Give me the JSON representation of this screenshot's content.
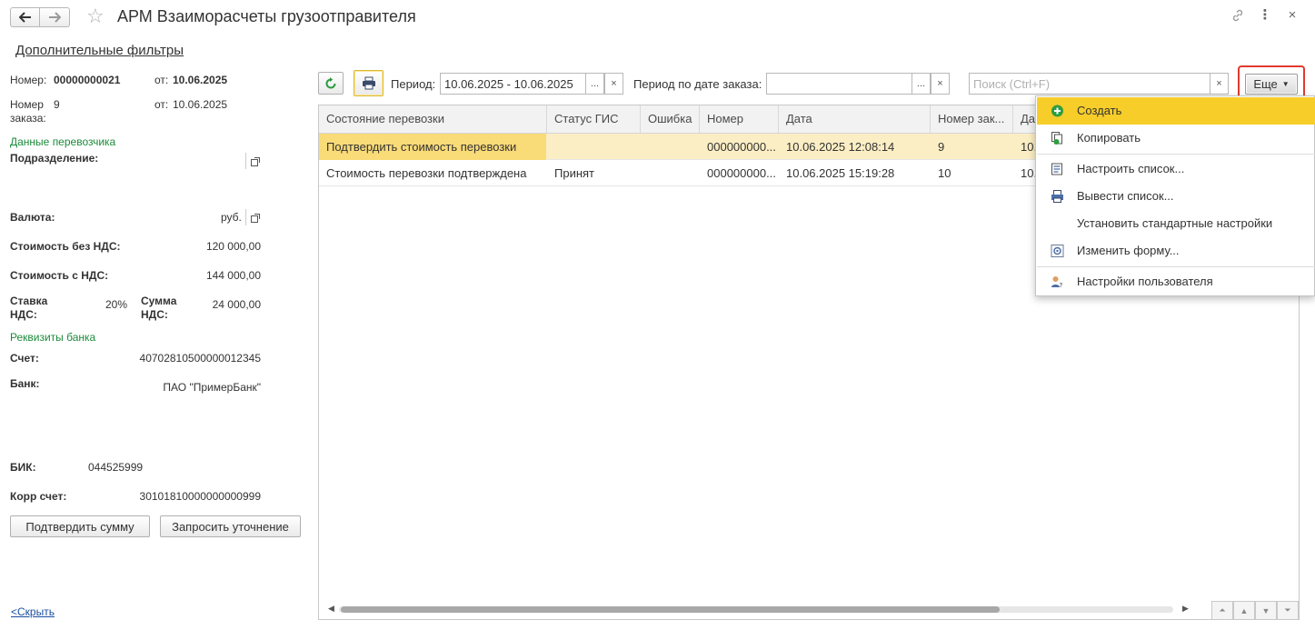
{
  "window": {
    "title": "АРМ Взаиморасчеты грузоотправителя"
  },
  "extra_filters_link": "Дополнительные фильтры",
  "left_panel": {
    "number_label": "Номер:",
    "number_value": "00000000021",
    "from_label_1": "от:",
    "from_value_1": "10.06.2025",
    "order_label_1": "Номер",
    "order_label_2": "заказа:",
    "order_value": "9",
    "from_label_2": "от:",
    "from_value_2": "10.06.2025",
    "carrier_section": "Данные перевозчика",
    "department_label": "Подразделение:",
    "currency_label": "Валюта:",
    "currency_value": "руб.",
    "cost_no_vat_label": "Стоимость без НДС:",
    "cost_no_vat_value": "120 000,00",
    "cost_vat_label": "Стоимость с НДС:",
    "cost_vat_value": "144 000,00",
    "vat_rate_label_1": "Ставка",
    "vat_rate_label_2": "НДС:",
    "vat_rate_value": "20%",
    "vat_sum_label_1": "Сумма",
    "vat_sum_label_2": "НДС:",
    "vat_sum_value": "24 000,00",
    "bank_section": "Реквизиты банка",
    "account_label": "Счет:",
    "account_value": "40702810500000012345",
    "bank_label": "Банк:",
    "bank_value": "ПАО \"ПримерБанк\"",
    "bik_label": "БИК:",
    "bik_value": "044525999",
    "corr_label": "Корр счет:",
    "corr_value": "30101810000000000999",
    "confirm_button": "Подтвердить сумму",
    "clarify_button": "Запросить уточнение",
    "hide_link": "<Скрыть"
  },
  "toolbar": {
    "period_label": "Период:",
    "period_value": "10.06.2025 - 10.06.2025",
    "order_period_label": "Период по дате заказа:",
    "order_period_value": "",
    "search_placeholder": "Поиск (Ctrl+F)",
    "more_button": "Еще",
    "ellipsis": "...",
    "clear": "×"
  },
  "table": {
    "columns": [
      "Состояние перевозки",
      "Статус ГИС",
      "Ошибка",
      "Номер",
      "Дата",
      "Номер зак...",
      "Да"
    ],
    "rows": [
      [
        "Подтвердить стоимость перевозки",
        "",
        "",
        "000000000...",
        "10.06.2025 12:08:14",
        "9",
        "10."
      ],
      [
        "Стоимость перевозки подтверждена",
        "Принят",
        "",
        "000000000...",
        "10.06.2025 15:19:28",
        "10",
        "10."
      ]
    ]
  },
  "menu": {
    "items": [
      {
        "label": "Создать",
        "icon": "plus-circle-icon"
      },
      {
        "label": "Копировать",
        "icon": "copy-icon"
      },
      {
        "label": "Настроить список...",
        "icon": "list-settings-icon"
      },
      {
        "label": "Вывести список...",
        "icon": "print-list-icon"
      },
      {
        "label": "Установить стандартные настройки",
        "icon": ""
      },
      {
        "label": "Изменить форму...",
        "icon": "form-icon"
      },
      {
        "label": "Настройки пользователя",
        "icon": "user-settings-icon"
      }
    ]
  },
  "colors": {
    "accent_yellow": "#f7cd2a",
    "selected_row": "#fbeec4",
    "section_green": "#1b8a3a",
    "highlight_red": "#e03a2f"
  }
}
